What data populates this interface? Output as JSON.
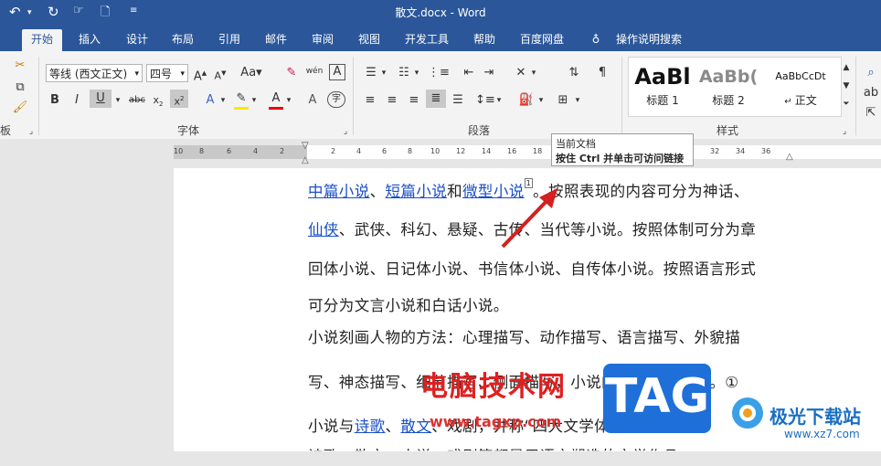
{
  "window": {
    "title": "散文.docx  -  Word"
  },
  "tabs": [
    "开始",
    "插入",
    "设计",
    "布局",
    "引用",
    "邮件",
    "审阅",
    "视图",
    "开发工具",
    "帮助",
    "百度网盘"
  ],
  "search_label": "操作说明搜索",
  "ribbon": {
    "font_name": "等线 (西文正文)",
    "font_size": "四号",
    "group_font": "字体",
    "group_paragraph": "段落",
    "group_styles": "样式",
    "group_clipboard": "板",
    "style1_sample": "AaBl",
    "style1_name": "标题 1",
    "style2_sample": "AaBb(",
    "style2_name": "标题 2",
    "style3_sample": "AaBbCcDt",
    "style3_name": "正文"
  },
  "ruler_ticks": [
    "10",
    "8",
    "6",
    "4",
    "2",
    "2",
    "4",
    "6",
    "8",
    "10",
    "12",
    "14",
    "16",
    "18",
    "32",
    "34",
    "36"
  ],
  "tooltip": {
    "line1": "当前文档",
    "line2": "按住 Ctrl 并单击可访问链接"
  },
  "doc": {
    "l1_a": "中篇小说",
    "l1_b": "、",
    "l1_c": "短篇小说",
    "l1_d": "和",
    "l1_e": "微型小说",
    "l1_f": "1",
    "l1_g": "。按照表现的内容可分为神话、",
    "l2_a": "仙侠",
    "l2_b": "、武侠、科幻、悬疑、古传、当代等小说。按照体制可分为章",
    "l3": "回体小说、日记体小说、书信体小说、自传体小说。按照语言形式",
    "l4": "可分为文言小说和白话小说。",
    "l5": "小说刻画人物的方法：心理描写、动作描写、语言描写、外貌描",
    "l6": "写、神态描写、细节描写、侧面描写，小说的三种写作方法。①",
    "l7_a": "小说与",
    "l7_b": "诗歌",
    "l7_c": "、",
    "l7_d": "散文",
    "l7_e": "、戏剧，并称“四大文学体裁”。（",
    "l7_f": "戏剧",
    "l8": "诗歌、散文、小说、戏剧等都是用语言塑造的文学作品"
  },
  "watermarks": {
    "w1": "电脑技术网",
    "w2": "www.tagxp.com",
    "w3": "TAG",
    "w4": "极光下载站",
    "w5": "www.xz7.com"
  }
}
